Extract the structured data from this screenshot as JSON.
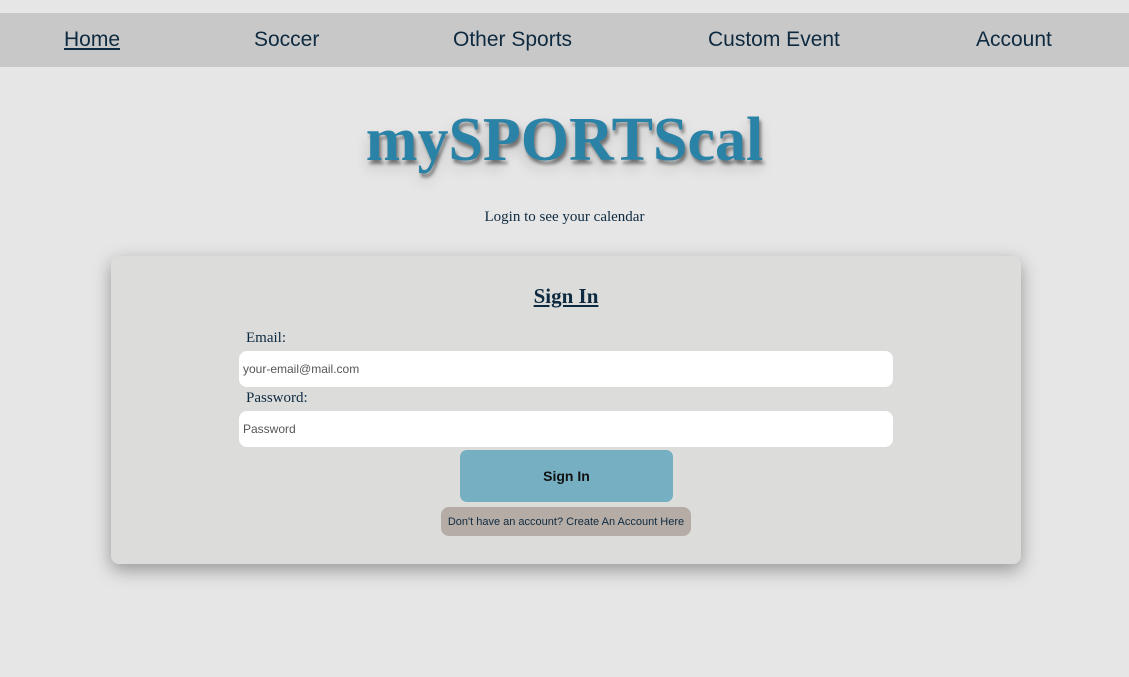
{
  "nav": {
    "home": "Home",
    "soccer": "Soccer",
    "other_sports": "Other Sports",
    "custom_event": "Custom Event",
    "account": "Account"
  },
  "header": {
    "logo": "mySPORTScal",
    "subtitle": "Login to see your calendar"
  },
  "signin": {
    "title": "Sign In",
    "email_label": "Email:",
    "email_placeholder": "your-email@mail.com",
    "password_label": "Password:",
    "password_placeholder": "Password",
    "submit_label": "Sign In",
    "create_account_label": "Don't have an account? Create An Account Here"
  },
  "colors": {
    "background": "#e6e6e6",
    "nav_bar": "#c8c8c8",
    "logo": "#2a82a6",
    "text": "#0e2a40",
    "card": "#dcdddb",
    "signin_button": "#77afc2",
    "create_account_button": "#b5aca6"
  }
}
